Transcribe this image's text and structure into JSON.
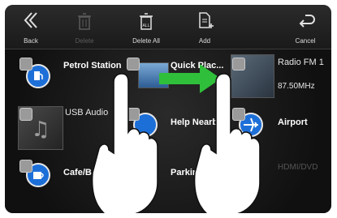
{
  "toolbar": {
    "back_label": "Back",
    "delete_label": "Delete",
    "delete_all_label": "Delete All",
    "add_label": "Add",
    "cancel_label": "Cancel"
  },
  "tiles": {
    "petrol": "Petrol Station",
    "quick": "Quick Plac...",
    "radio": "Radio FM 1",
    "radio_freq": "87.50MHz",
    "usb": "USB Audio",
    "help": "Help Nearby",
    "airport": "Airport",
    "cafe": "Cafe/B",
    "parking": "Parkin",
    "hdmi": "HDMI/DVD"
  },
  "colors": {
    "accent_blue": "#1d6fd8",
    "gesture_arrow": "#2fbf3a"
  }
}
